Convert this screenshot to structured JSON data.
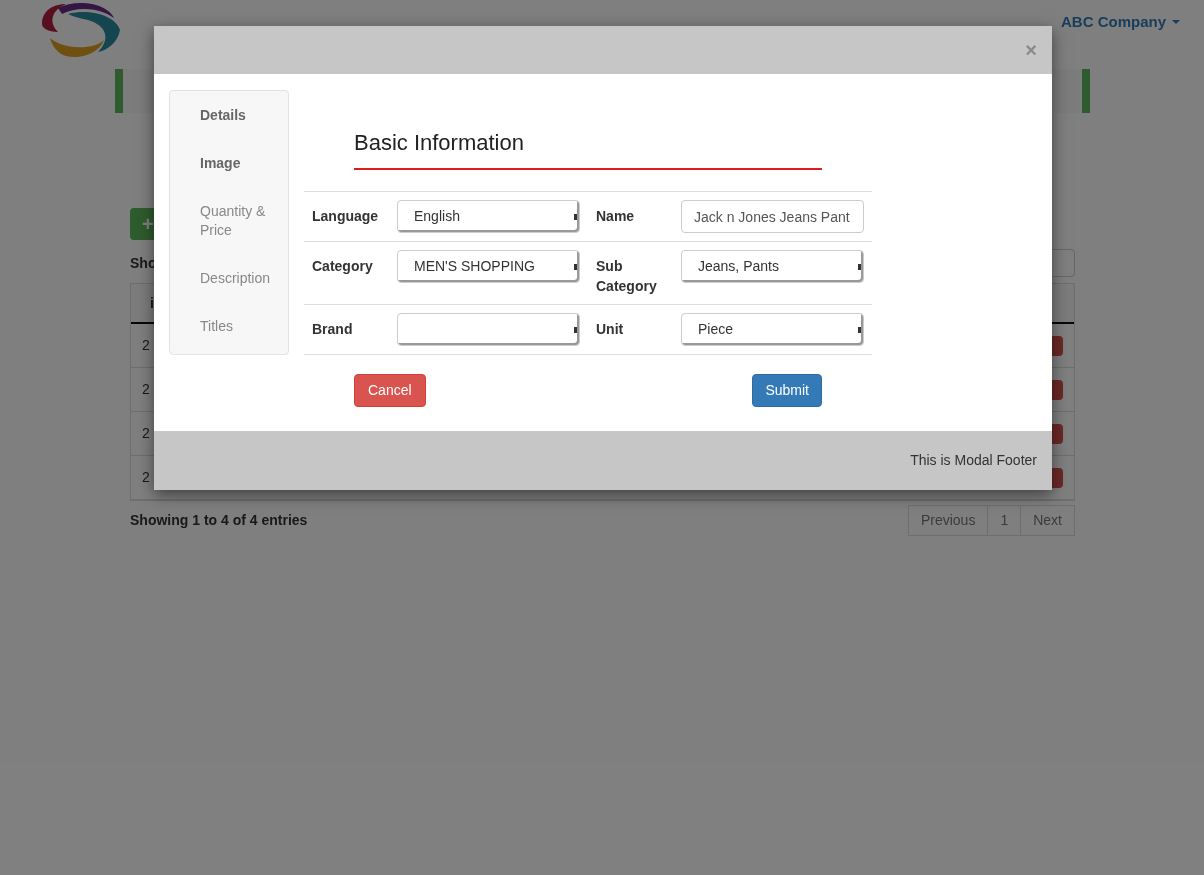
{
  "page": {
    "account": "ABC Company",
    "add_button": "+",
    "length_text": "Sho",
    "table": {
      "columns": [
        "i"
      ],
      "rows": [
        {
          "cells": [
            "2"
          ]
        },
        {
          "cells": [
            "2"
          ]
        },
        {
          "cells": [
            "2"
          ]
        },
        {
          "cells": [
            "2"
          ]
        }
      ]
    },
    "info": "Showing 1 to 4 of 4 entries",
    "pagination": [
      {
        "label": "Previous",
        "disabled": true
      },
      {
        "label": "1",
        "disabled": true
      },
      {
        "label": "Next",
        "disabled": true
      }
    ]
  },
  "modal": {
    "close": "×",
    "steps": [
      {
        "label": "Details",
        "active": true
      },
      {
        "label": "Image",
        "active": true
      },
      {
        "label": "Quantity & Price",
        "active": false
      },
      {
        "label": "Description",
        "active": false
      },
      {
        "label": "Titles",
        "active": false
      }
    ],
    "heading": "Basic Information",
    "rows": [
      [
        {
          "label": "Language",
          "kind": "select",
          "value": "English"
        },
        {
          "label": "Name",
          "kind": "text",
          "value": "Jack n Jones Jeans Pant"
        }
      ],
      [
        {
          "label": "Category",
          "kind": "select",
          "value": "MEN'S SHOPPING"
        },
        {
          "label": "Sub Category",
          "kind": "select",
          "value": "Jeans, Pants"
        }
      ],
      [
        {
          "label": "Brand",
          "kind": "select"
        },
        {
          "label": "Unit",
          "kind": "select",
          "value": "Piece"
        }
      ]
    ],
    "cancel": "Cancel",
    "submit": "Submit",
    "footer": "This is Modal Footer"
  }
}
